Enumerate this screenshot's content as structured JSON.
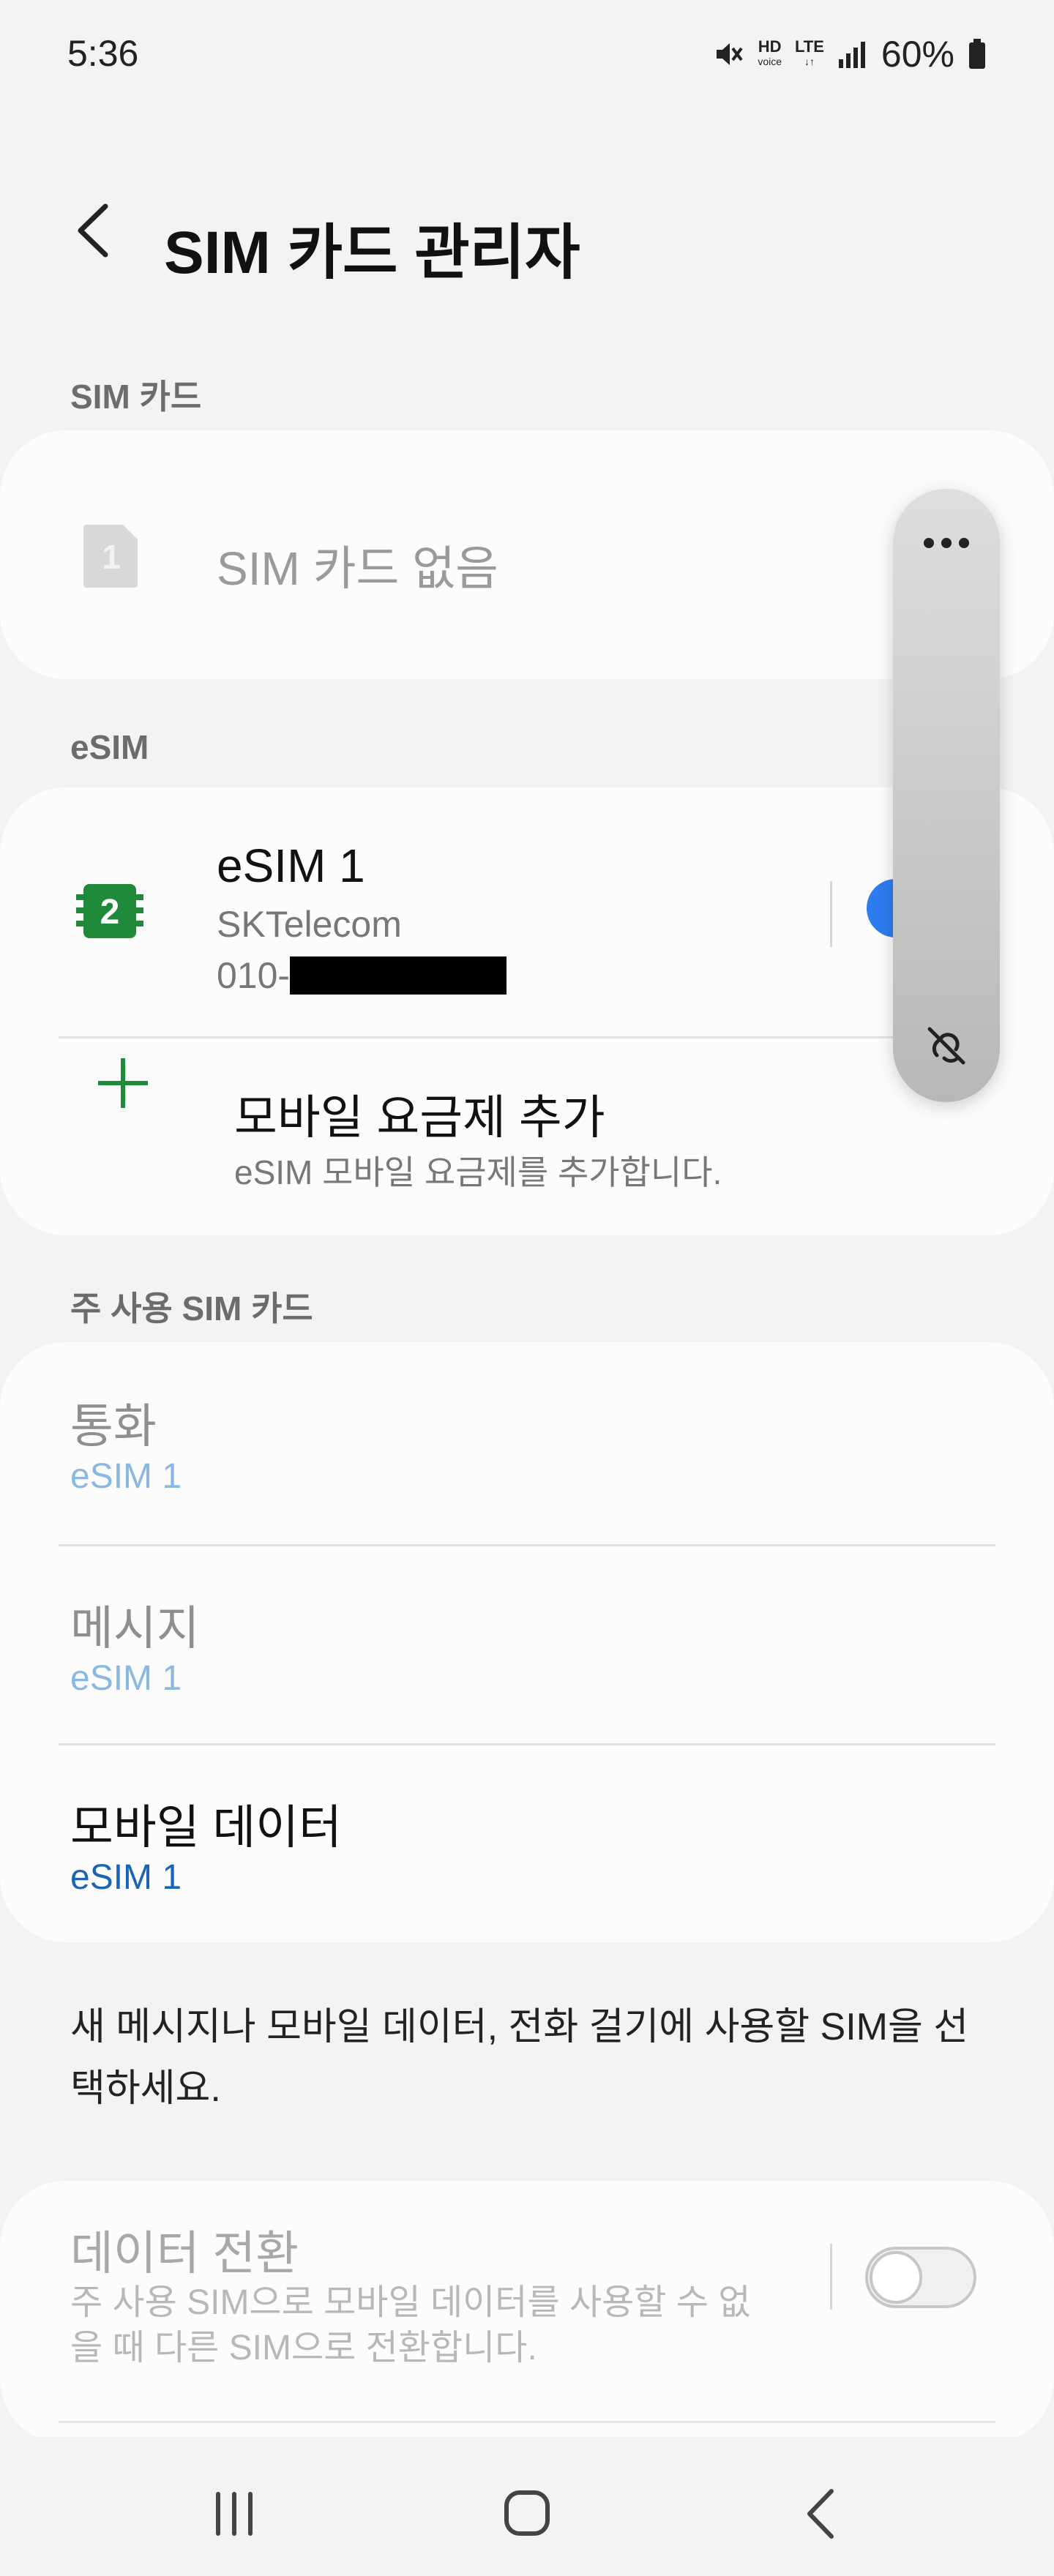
{
  "status_bar": {
    "time": "5:36",
    "icons": [
      "mute-icon",
      "hd-voice-icon",
      "lte-icon",
      "signal-icon",
      "battery-icon"
    ],
    "hd_label": "HD",
    "voice_label": "voice",
    "lte_label": "LTE",
    "battery": "60%"
  },
  "header": {
    "title": "SIM 카드 관리자",
    "back_icon": "chevron-left-icon"
  },
  "sim_section": {
    "header": "SIM 카드",
    "slot_number": "1",
    "empty_label": "SIM 카드 없음"
  },
  "esim_section": {
    "header": "eSIM",
    "slot_number": "2",
    "name": "eSIM 1",
    "carrier": "SKTelecom",
    "number_prefix": "010-",
    "enabled": true,
    "add_title": "모바일 요금제 추가",
    "add_subtitle": "eSIM 모바일 요금제를 추가합니다."
  },
  "preferred_section": {
    "header": "주 사용 SIM 카드",
    "items": [
      {
        "title": "통화",
        "value": "eSIM 1",
        "enabled": false
      },
      {
        "title": "메시지",
        "value": "eSIM 1",
        "enabled": false
      },
      {
        "title": "모바일 데이터",
        "value": "eSIM 1",
        "enabled": true
      }
    ]
  },
  "note": "새 메시지나 모바일 데이터, 전화 걸기에 사용할 SIM을 선택하세요.",
  "data_switch": {
    "title": "데이터 전환",
    "subtitle": "주 사용 SIM으로 모바일 데이터를 사용할 수 없을 때 다른 SIM으로 전환합니다.",
    "enabled": false
  },
  "floating_panel": {
    "icons": [
      "more-options-icon",
      "hide-panel-icon"
    ]
  },
  "nav_bar": {
    "icons": [
      "recent-apps-icon",
      "home-icon",
      "back-icon"
    ]
  },
  "colors": {
    "background": "#f3f3f3",
    "card": "#fcfcfc",
    "accent_blue": "#2d7cf0",
    "value_blue": "#1a64b8",
    "esim_green": "#1f8a3a"
  }
}
